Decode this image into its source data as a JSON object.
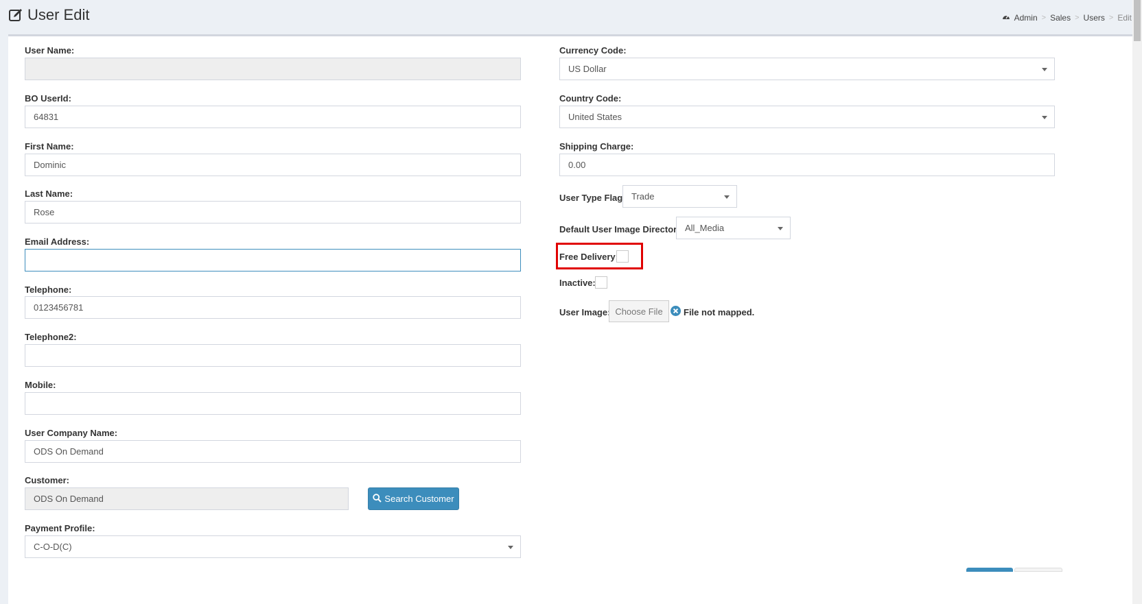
{
  "header": {
    "title": "User Edit",
    "breadcrumb": [
      "Admin",
      "Sales",
      "Users",
      "Edit"
    ]
  },
  "left": {
    "user_name": {
      "label": "User Name:",
      "value": ""
    },
    "bo_userid": {
      "label": "BO UserId:",
      "value": "64831"
    },
    "first_name": {
      "label": "First Name:",
      "value": "Dominic"
    },
    "last_name": {
      "label": "Last Name:",
      "value": "Rose"
    },
    "email": {
      "label": "Email Address:",
      "value": ""
    },
    "telephone": {
      "label": "Telephone:",
      "value": "0123456781"
    },
    "telephone2": {
      "label": "Telephone2:",
      "value": ""
    },
    "mobile": {
      "label": "Mobile:",
      "value": ""
    },
    "company": {
      "label": "User Company Name:",
      "value": "ODS On Demand"
    },
    "customer": {
      "label": "Customer:",
      "value": "ODS On Demand",
      "search_label": "Search Customer"
    },
    "payment_profile": {
      "label": "Payment Profile:",
      "value": "C-O-D(C)"
    }
  },
  "right": {
    "currency": {
      "label": "Currency Code:",
      "value": "US Dollar"
    },
    "country": {
      "label": "Country Code:",
      "value": "United States"
    },
    "shipping": {
      "label": "Shipping Charge:",
      "value": "0.00"
    },
    "user_type": {
      "label": "User Type Flag:",
      "value": "Trade"
    },
    "image_dir": {
      "label": "Default User Image Directory",
      "value": "All_Media"
    },
    "free_delivery": {
      "label": "Free Delivery:",
      "checked": false
    },
    "inactive": {
      "label": "Inactive:",
      "checked": false
    },
    "user_image": {
      "label": "User Image:",
      "button": "Choose File",
      "status": "File not mapped."
    }
  },
  "colors": {
    "accent": "#3c8dbc",
    "highlight": "#e00000",
    "background": "#ecf0f5"
  }
}
